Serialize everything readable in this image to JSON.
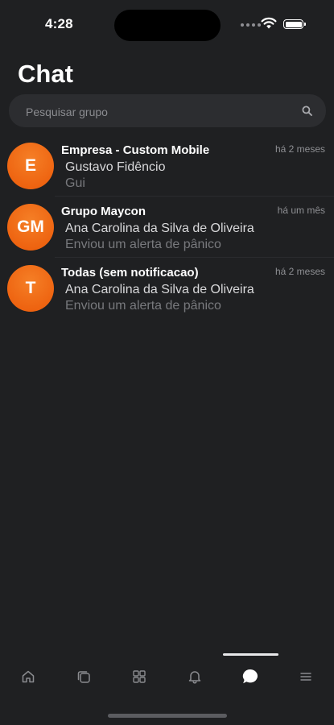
{
  "status_bar": {
    "time": "4:28"
  },
  "header": {
    "title": "Chat"
  },
  "search": {
    "placeholder": "Pesquisar grupo",
    "value": ""
  },
  "chats": [
    {
      "initials": "E",
      "title": "Empresa - Custom Mobile",
      "time": "há 2 meses",
      "sender": "Gustavo Fidêncio",
      "preview": "Gui"
    },
    {
      "initials": "GM",
      "title": "Grupo Maycon",
      "time": "há um mês",
      "sender": "Ana Carolina da Silva de Oliveira",
      "preview": "Enviou um alerta de pânico"
    },
    {
      "initials": "T",
      "title": "Todas (sem notificacao)",
      "time": "há 2 meses",
      "sender": "Ana Carolina da Silva de Oliveira",
      "preview": "Enviou um alerta de pânico"
    }
  ],
  "tab_bar": {
    "active": "chat",
    "tabs": [
      {
        "id": "home",
        "icon": "home-icon"
      },
      {
        "id": "pages",
        "icon": "copy-icon"
      },
      {
        "id": "apps",
        "icon": "grid-icon"
      },
      {
        "id": "alerts",
        "icon": "bell-icon"
      },
      {
        "id": "chat",
        "icon": "chat-bubble-icon"
      },
      {
        "id": "menu",
        "icon": "menu-icon"
      }
    ]
  },
  "colors": {
    "background": "#1f2022",
    "avatar": "#ee6411",
    "search_bg": "#2c2d30",
    "muted_text": "#8e8f93"
  }
}
